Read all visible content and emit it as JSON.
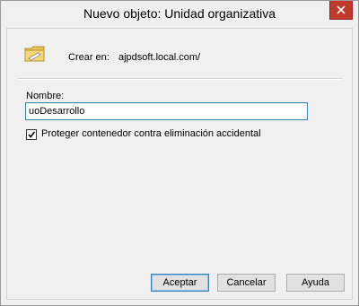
{
  "window": {
    "title": "Nuevo objeto: Unidad organizativa"
  },
  "header": {
    "icon": "organizational-unit-folder-icon",
    "create_in_label": "Crear en:",
    "create_in_value": "ajpdsoft.local.com/"
  },
  "form": {
    "name_label": "Nombre:",
    "name_value": "uoDesarrollo",
    "protect_checked": true,
    "protect_label": "Proteger contenedor contra eliminación accidental"
  },
  "buttons": {
    "ok": "Aceptar",
    "cancel": "Cancelar",
    "help": "Ayuda"
  },
  "colors": {
    "close_button": "#c0392b",
    "focus_border": "#3c7fb1"
  }
}
